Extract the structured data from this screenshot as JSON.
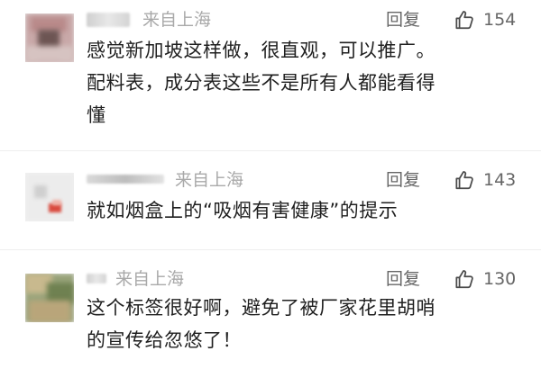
{
  "comments": [
    {
      "location": "来自上海",
      "reply_label": "回复",
      "likes": "154",
      "text": "感觉新加坡这样做，很直观，可以推广。\n配料表，成分表这些不是所有人都能看得\n懂"
    },
    {
      "location": "来自上海",
      "reply_label": "回复",
      "likes": "143",
      "text": "就如烟盒上的“吸烟有害健康”的提示"
    },
    {
      "location": "来自上海",
      "reply_label": "回复",
      "likes": "130",
      "text": "这个标签很好啊，避免了被厂家花里胡哨\n的宣传给忽悠了！"
    }
  ],
  "colors": {
    "meta_text": "#a9a9a9",
    "action_text": "#666666",
    "body_text": "#1f1f1f"
  },
  "icons": {
    "like": "thumb-up-icon"
  }
}
